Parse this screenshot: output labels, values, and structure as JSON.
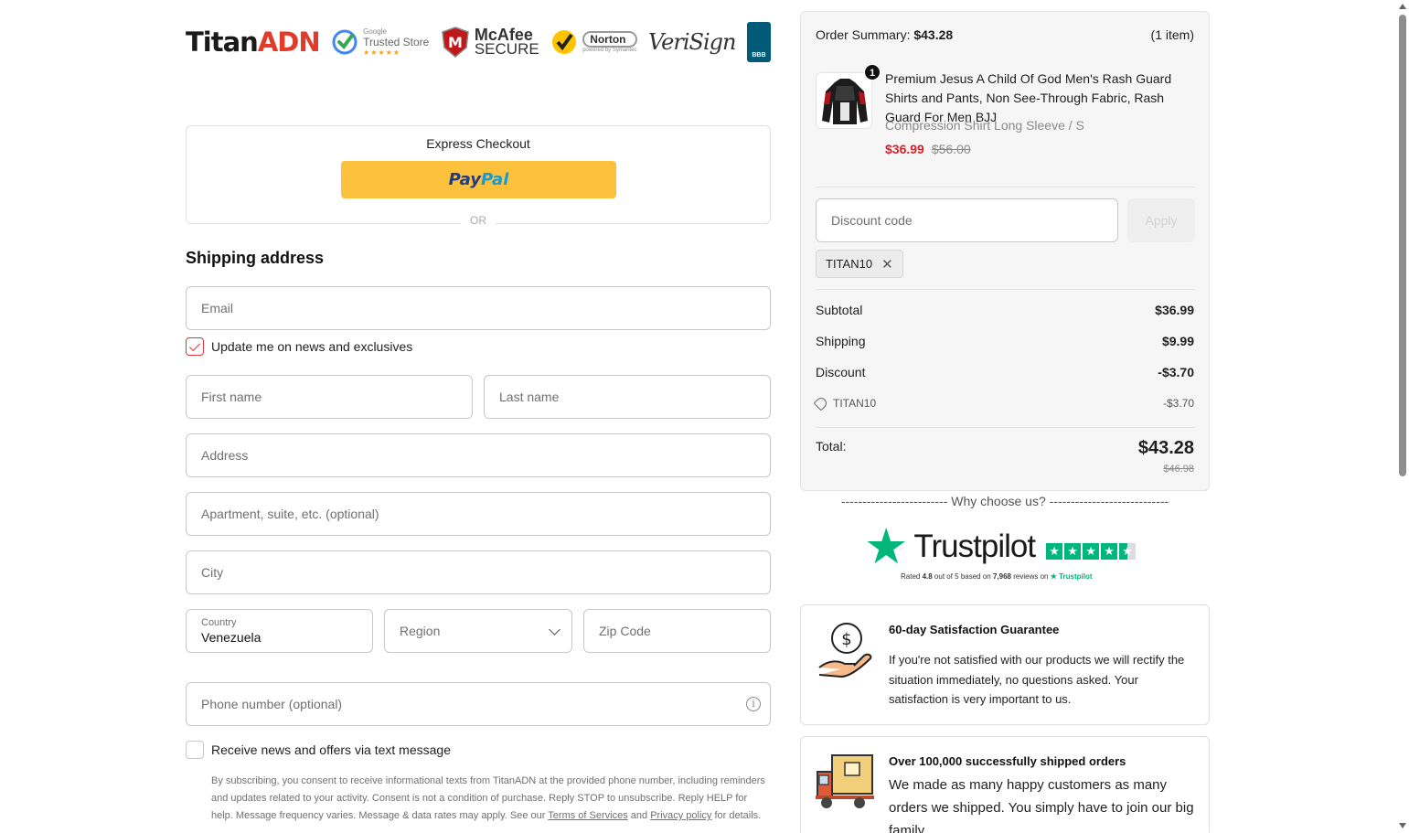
{
  "brand": {
    "part1": "Titan",
    "part2": "ADN"
  },
  "trust_badges": {
    "trusted_store": {
      "small": "Google",
      "label": "Trusted Store",
      "stars": "★★★★★"
    },
    "mcafee": {
      "name": "McAfee",
      "sub": "SECURE"
    },
    "norton": {
      "name": "Norton",
      "sub": "powered by Symantec"
    },
    "verisign": {
      "name": "VeriSign"
    },
    "bbb": {
      "name": "BBB"
    }
  },
  "express": {
    "title": "Express Checkout",
    "paypal_1": "Pay",
    "paypal_2": "Pal",
    "or": "OR"
  },
  "shipping": {
    "title": "Shipping address",
    "email_placeholder": "Email",
    "news_label": "Update me on news and exclusives",
    "news_checked": true,
    "first_name_placeholder": "First name",
    "last_name_placeholder": "Last name",
    "address_placeholder": "Address",
    "apartment_placeholder": "Apartment, suite, etc. (optional)",
    "city_placeholder": "City",
    "country_label": "Country",
    "country_value": "Venezuela",
    "region_placeholder": "Region",
    "zip_placeholder": "Zip Code",
    "phone_placeholder": "Phone number (optional)",
    "sms_label": "Receive news and offers via text message",
    "sms_checked": false,
    "disclaimer_1": "By subscribing, you consent to receive informational texts from TitanADN at the provided phone number, including reminders and updates related to your activity. Consent is not a condition of purchase. Reply STOP to unsubscribe. Reply HELP for help. Message frequency varies. Message & data rates may apply. See our ",
    "terms_link": "Terms of Services",
    "disclaimer_and": " and ",
    "privacy_link": "Privacy policy",
    "disclaimer_end": " for details."
  },
  "summary": {
    "label": "Order Summary: ",
    "total_head": "$43.28",
    "item_count": "(1 item)",
    "product": {
      "quantity": "1",
      "title": "Premium Jesus A Child Of God Men's Rash Guard Shirts and Pants, Non See-Through Fabric, Rash Guard For Men BJJ",
      "variant": "Compression Shirt Long Sleeve / S",
      "price": "$36.99",
      "compare_price": "$56.00"
    },
    "discount_placeholder": "Discount code",
    "apply_label": "Apply",
    "applied_code": "TITAN10",
    "subtotal_label": "Subtotal",
    "subtotal_value": "$36.99",
    "shipping_label": "Shipping",
    "shipping_value": "$9.99",
    "discount_label": "Discount",
    "discount_value": "-$3.70",
    "code_line_label": "TITAN10",
    "code_line_value": "-$3.70",
    "total_label": "Total:",
    "total_value": "$43.28",
    "total_compare": "$46.98"
  },
  "why": {
    "text": "------------------------- Why choose us? ----------------------------"
  },
  "trustpilot": {
    "name": "Trustpilot",
    "rated_prefix": "Rated ",
    "rating": "4.8",
    "rated_mid": " out of 5 based on ",
    "reviews": "7,968",
    "rated_suffix": " reviews on ",
    "brand_small": "★ Trustpilot"
  },
  "cards": {
    "guarantee": {
      "title": "60-day Satisfaction Guarantee",
      "body": "If you're not satisfied with our products we will rectify the situation immediately, no questions asked. Your satisfaction is very important to us."
    },
    "orders": {
      "title": "Over 100,000 successfully shipped orders",
      "body": "We made as many happy customers as many orders we shipped. You simply have to join our big family."
    }
  },
  "colors": {
    "accent_red": "#d9202a",
    "paypal_yellow": "#fcc23d",
    "trustpilot_green": "#00b67a"
  }
}
